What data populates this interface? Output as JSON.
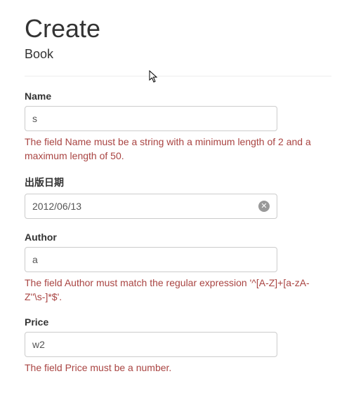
{
  "header": {
    "title": "Create",
    "subtitle": "Book"
  },
  "form": {
    "name": {
      "label": "Name",
      "value": "s",
      "error": "The field Name must be a string with a minimum length of 2 and a maximum length of 50."
    },
    "publish_date": {
      "label": "出版日期",
      "value": "2012/06/13"
    },
    "author": {
      "label": "Author",
      "value": "a",
      "error": "The field Author must match the regular expression '^[A-Z]+[a-zA-Z''\\s-]*$'."
    },
    "price": {
      "label": "Price",
      "value": "w2",
      "error": "The field Price must be a number."
    }
  }
}
